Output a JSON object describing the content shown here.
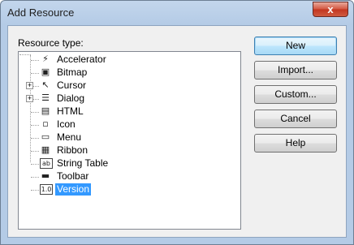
{
  "window": {
    "title": "Add Resource",
    "close_glyph": "x"
  },
  "resource_type_label": "Resource type:",
  "tree": {
    "items": [
      {
        "label": "Accelerator",
        "icon": "accelerator-icon",
        "glyph": "⚡",
        "expandable": false,
        "selected": false
      },
      {
        "label": "Bitmap",
        "icon": "bitmap-icon",
        "glyph": "▣",
        "expandable": false,
        "selected": false
      },
      {
        "label": "Cursor",
        "icon": "cursor-icon",
        "glyph": "↖",
        "expandable": true,
        "selected": false
      },
      {
        "label": "Dialog",
        "icon": "dialog-icon",
        "glyph": "☰",
        "expandable": true,
        "selected": false
      },
      {
        "label": "HTML",
        "icon": "html-icon",
        "glyph": "▤",
        "expandable": false,
        "selected": false
      },
      {
        "label": "Icon",
        "icon": "icon-resource-icon",
        "glyph": "▫",
        "expandable": false,
        "selected": false
      },
      {
        "label": "Menu",
        "icon": "menu-icon",
        "glyph": "▭",
        "expandable": false,
        "selected": false
      },
      {
        "label": "Ribbon",
        "icon": "ribbon-icon",
        "glyph": "▦",
        "expandable": false,
        "selected": false
      },
      {
        "label": "String Table",
        "icon": "string-table-icon",
        "glyph": "ab",
        "expandable": false,
        "selected": false
      },
      {
        "label": "Toolbar",
        "icon": "toolbar-icon",
        "glyph": "▬",
        "expandable": false,
        "selected": false
      },
      {
        "label": "Version",
        "icon": "version-icon",
        "glyph": "1.0",
        "expandable": false,
        "selected": true
      }
    ]
  },
  "buttons": {
    "new": "New",
    "import": "Import...",
    "custom": "Custom...",
    "cancel": "Cancel",
    "help": "Help"
  }
}
